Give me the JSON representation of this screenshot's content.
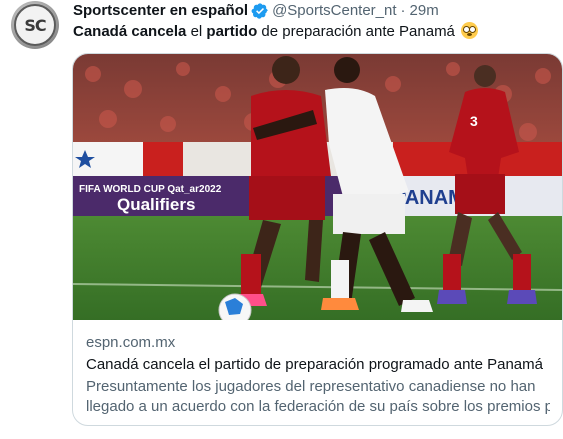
{
  "tweet": {
    "display_name": "Sportscenter en español",
    "handle": "@SportsCenter_nt",
    "separator": "·",
    "time": "29m",
    "verified": true,
    "text_parts": [
      "Canadá cancela",
      " el ",
      "partido",
      " de preparación ante Panamá"
    ],
    "emoji": "flushed-face-emoji"
  },
  "card": {
    "domain": "espn.com.mx",
    "title": "Canadá cancela el partido de preparación programado ante Panamá",
    "description_line1": "Presuntamente los jugadores del representativo canadiense no han",
    "description_line2": "llegado a un acuerdo con la federación de su país sobre los premios p...",
    "image": {
      "banner_text": "FIFA WORLD CUP Qat_ar2022",
      "banner_sub": "Qualifiers",
      "board_text": "PANAMÁ",
      "player_number": "3",
      "colors": {
        "panama_red": "#b5121b",
        "canada_white": "#f4f4f4",
        "pitch": "#3f7a2a"
      }
    }
  },
  "colors": {
    "text_primary": "#0f1419",
    "text_secondary": "#536471",
    "verified_blue": "#1d9bf0",
    "border": "#cfd9de"
  }
}
